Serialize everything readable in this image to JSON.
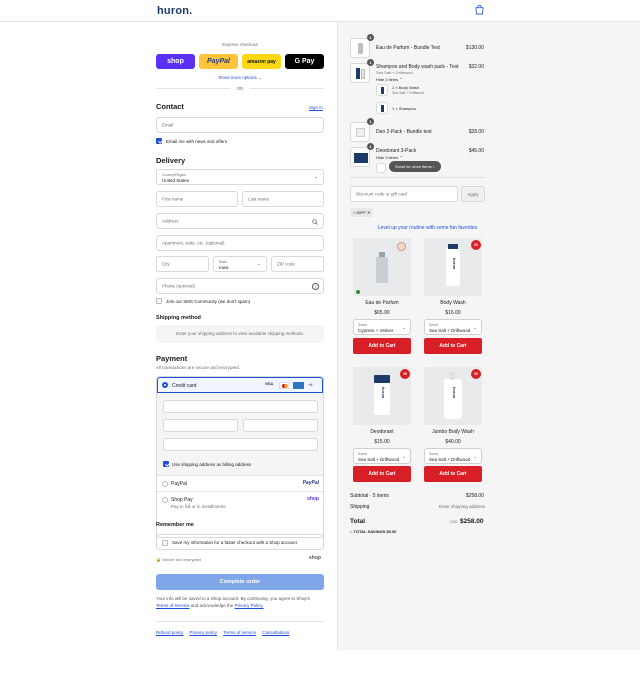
{
  "header": {
    "logo": "huron."
  },
  "express": {
    "title": "Express checkout",
    "shop": "shop",
    "paypal": "PayPal",
    "amazon": "amazon pay",
    "gpay": "G Pay",
    "more": "Show more options",
    "or": "OR"
  },
  "contact": {
    "title": "Contact",
    "signin": "Sign in",
    "email_placeholder": "Email",
    "news": "Email me with news and offers"
  },
  "delivery": {
    "title": "Delivery",
    "country_label": "Country/Region",
    "country_value": "United States",
    "first": "First name",
    "last": "Last name",
    "address": "Address",
    "apt": "Apartment, suite, etc. (optional)",
    "city": "City",
    "state_label": "State",
    "state_value": "Iowa",
    "zip": "ZIP code",
    "phone": "Phone (optional)",
    "sms": "Join our SMS Community (we don't spam)"
  },
  "shipping": {
    "title": "Shipping method",
    "note": "Enter your shipping address to view available shipping methods."
  },
  "payment": {
    "title": "Payment",
    "subtitle": "All transactions are secure and encrypted.",
    "credit": "Credit card",
    "more_cards": "+4",
    "billing": "Use shipping address as billing address",
    "paypal": "PayPal",
    "paypal_logo": "PayPal",
    "shoppay": "Shop Pay",
    "shoppay_sub": "Pay in full or in installments",
    "shoppay_logo": "shop"
  },
  "remember": {
    "title": "Remember me",
    "save": "Save my information for a faster checkout with a Shop account",
    "secure": "Secure and encrypted",
    "shop": "shop"
  },
  "complete": "Complete order",
  "legal": {
    "l1": "Your info will be saved to a Shop account. By continuing, you agree to Shop's",
    "terms": "Terms of Service",
    "and": "and acknowledge the",
    "privacy": "Privacy Policy."
  },
  "footer": [
    "Refund policy",
    "Privacy policy",
    "Terms of service",
    "Cancellations"
  ],
  "order": {
    "items": [
      {
        "qty": "1",
        "name": "Eau de Parfum - Bundle Test",
        "price": "$130.00"
      },
      {
        "qty": "1",
        "name": "Shampoo and Body wash pack - Test",
        "variant": "Sea Salt + Driftwood",
        "toggle": "Hide 2 items",
        "price": "$32.00"
      },
      {
        "qty": "1",
        "name": "Deo 2-Pack - Bundle test",
        "price": "$28.00"
      },
      {
        "qty": "1",
        "name": "Deodorant 3-Pack",
        "toggle": "Hide 3 items",
        "price": "$45.00"
      }
    ],
    "sub1": [
      {
        "name": "1 × Body Wash",
        "variant": "Sea Salt + Driftwood"
      },
      {
        "name": "1 × Shampoo"
      }
    ],
    "scroll_hint": "Scroll for more items",
    "discount_placeholder": "Discount code or gift card",
    "apply": "Apply",
    "tag": "50FF",
    "upsell_title": "Level up your routine with some fan favorites",
    "products": [
      {
        "name": "Eau de Parfum",
        "price": "$65.00",
        "scent_label": "Scent",
        "scent": "Cypress + Vetiver",
        "btn": "Add to Cart"
      },
      {
        "name": "Body Wash",
        "price": "$16.00",
        "scent_label": "Scent",
        "scent": "Sea Salt + Driftwood",
        "btn": "Add to Cart",
        "badge": "20"
      },
      {
        "name": "Deodorant",
        "price": "$15.00",
        "scent_label": "Scent",
        "scent": "Sea Salt + Driftwood",
        "btn": "Add to Cart",
        "badge": "20"
      },
      {
        "name": "Jumbo Body Wash",
        "price": "$40.00",
        "scent_label": "Scent",
        "scent": "Sea Salt + Driftwood",
        "btn": "Add to Cart",
        "badge": "20"
      }
    ],
    "subtotal_label": "Subtotal · 5 items",
    "subtotal": "$258.00",
    "shipping_label": "Shipping",
    "shipping_value": "Enter shipping address",
    "total_label": "Total",
    "currency": "USD",
    "total": "$258.00",
    "savings_label": "TOTAL SAVINGS",
    "savings": "$5.00"
  },
  "colors": {
    "accent": "#1d4ed8",
    "brand": "#1d3a6b",
    "cta": "#d81f26",
    "complete_btn": "#7ea6e8"
  }
}
